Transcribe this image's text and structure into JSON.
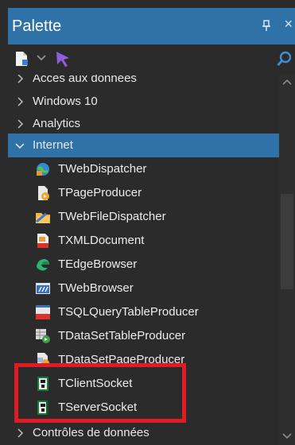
{
  "palette": {
    "title": "Palette",
    "categories": {
      "acces": "Accès aux données",
      "windows10": "Windows 10",
      "analytics": "Analytics",
      "internet": "Internet",
      "controles": "Contrôles de données"
    },
    "items": [
      "TWebDispatcher",
      "TPageProducer",
      "TWebFileDispatcher",
      "TXMLDocument",
      "TEdgeBrowser",
      "TWebBrowser",
      "TSQLQueryTableProducer",
      "TDataSetTableProducer",
      "TDataSetPageProducer",
      "TClientSocket",
      "TServerSocket"
    ],
    "icons": {
      "close": "close-icon",
      "pin": "pin-icon",
      "search": "search-icon"
    }
  },
  "colors": {
    "accent": "#2f72a7",
    "background": "#2b2b2b",
    "highlight": "#e01b24"
  }
}
